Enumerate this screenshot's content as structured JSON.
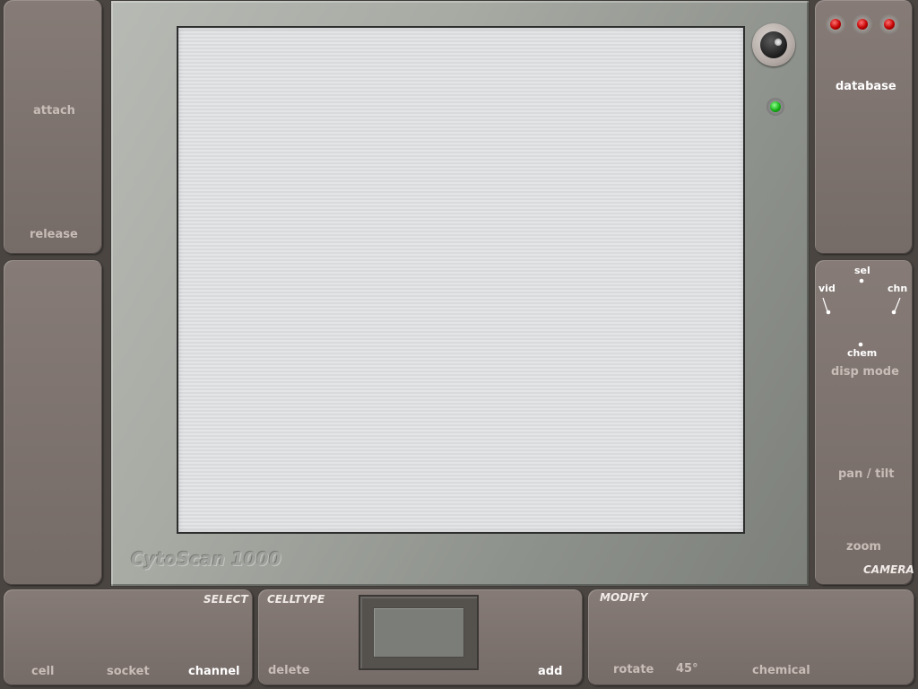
{
  "left": {
    "attach_label": "attach",
    "release_label": "release"
  },
  "monitor": {
    "brand": "CytoScan 1000"
  },
  "right": {
    "database_label": "database",
    "dial": {
      "sel": "sel",
      "vid": "vid",
      "chn": "chn",
      "chem": "chem"
    },
    "disp_mode_label": "disp mode",
    "pan_tilt_label": "pan / tilt",
    "zoom_label": "zoom",
    "camera_label": "CAMERA"
  },
  "select_panel": {
    "title": "SELECT",
    "cell": "cell",
    "socket": "socket",
    "channel": "channel"
  },
  "celltype_panel": {
    "title": "CELLTYPE",
    "delete": "delete",
    "add": "add"
  },
  "modify_panel": {
    "title": "MODIFY",
    "rotate": "rotate",
    "angle": "45°",
    "chemical": "chemical"
  },
  "colors": {
    "panel": "#7d736e",
    "indicator_red": "#c20000",
    "indicator_green": "#17b117",
    "screen": "#e0e2e4"
  }
}
